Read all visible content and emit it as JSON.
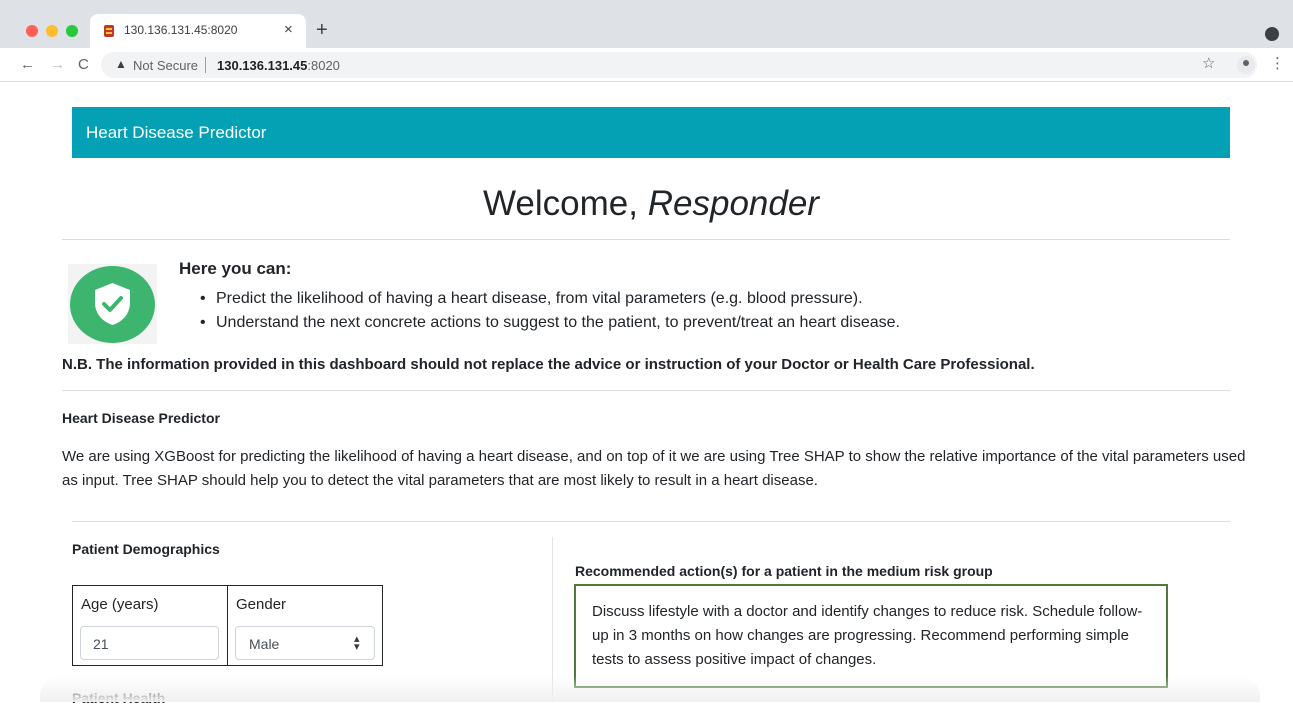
{
  "browser": {
    "tab_title": "130.136.131.45:8020",
    "tab_close": "×",
    "new_tab": "+",
    "nav": {
      "back": "←",
      "forward": "→",
      "reload": "C"
    },
    "security_label": "Not Secure",
    "url_host": "130.136.131.45",
    "url_port": ":8020",
    "star": "☆",
    "menu": "⋮"
  },
  "navbar": {
    "brand": "Heart Disease Predictor",
    "color": "#04a1b4"
  },
  "welcome": {
    "prefix": "Welcome,",
    "name": "Responder"
  },
  "intro": {
    "title": "Here you can:",
    "bullets": [
      "Predict the likelihood of having a heart disease, from vital parameters (e.g. blood pressure).",
      "Understand the next concrete actions to suggest to the patient, to prevent/treat an heart disease."
    ],
    "icon": "shield-check-icon",
    "icon_color": "#3db56e"
  },
  "disclaimer": "N.B. The information provided in this dashboard should not replace the advice or instruction of your Doctor or Health Care Professional.",
  "predictor": {
    "title": "Heart Disease Predictor",
    "description": "We are using XGBoost for predicting the likelihood of having a heart disease, and on top of it we are using Tree SHAP to show the relative importance of the vital parameters used as input. Tree SHAP should help you to detect the vital parameters that are most likely to result in a heart disease."
  },
  "demographics": {
    "title": "Patient Demographics",
    "age_label": "Age (years)",
    "age_value": "21",
    "gender_label": "Gender",
    "gender_value": "Male",
    "gender_arrow": "⬍"
  },
  "recommendation": {
    "title": "Recommended action(s) for a patient in the medium risk group",
    "text": "Discuss lifestyle with a doctor and identify changes to reduce risk. Schedule follow-up in 3 months on how changes are progressing. Recommend performing simple tests to assess positive impact of changes.",
    "border_color": "#4f7a3a"
  },
  "health": {
    "title": "Patient Health"
  }
}
